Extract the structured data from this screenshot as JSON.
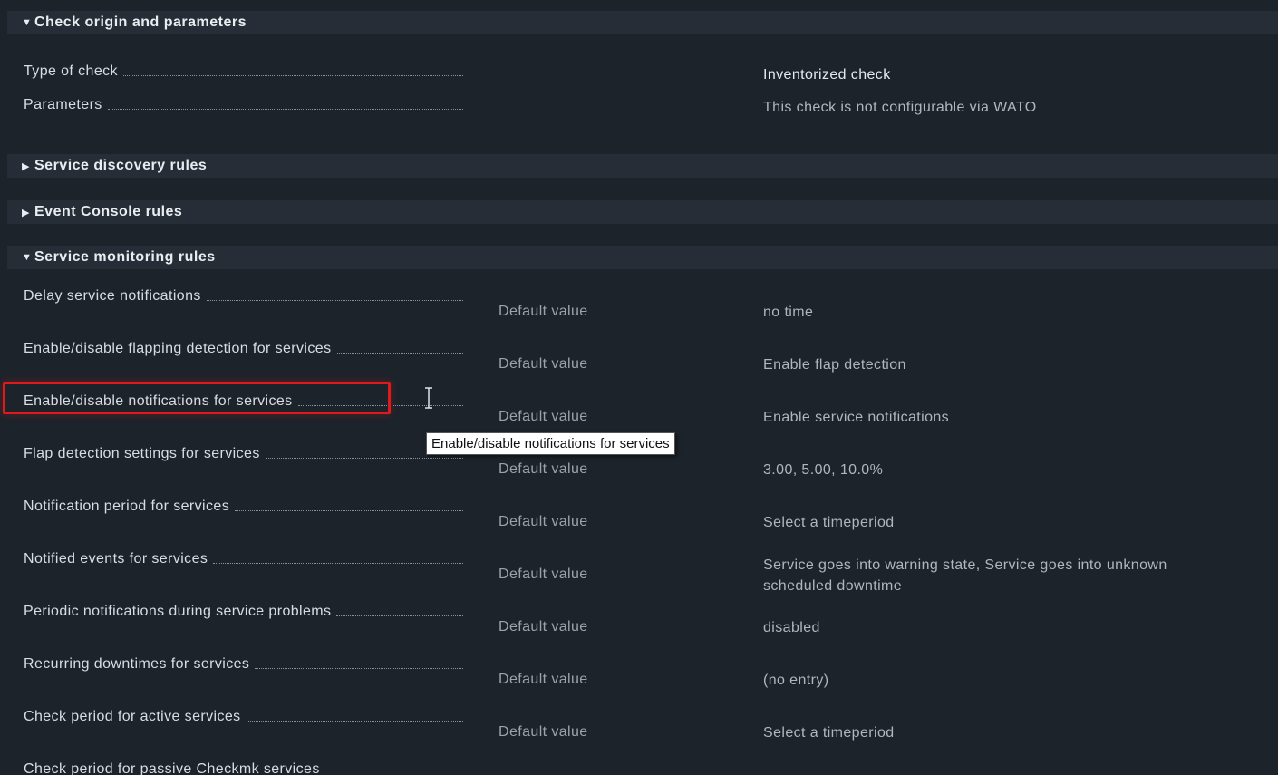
{
  "sections": {
    "origin": {
      "title": "Check origin and parameters",
      "expanded": true,
      "rows": [
        {
          "label": "Type of check",
          "value": "Inventorized check"
        },
        {
          "label": "Parameters",
          "value": "This check is not configurable via WATO"
        }
      ]
    },
    "discovery": {
      "title": "Service discovery rules",
      "expanded": false
    },
    "event_console": {
      "title": "Event Console rules",
      "expanded": false
    },
    "monitoring": {
      "title": "Service monitoring rules",
      "expanded": true,
      "rows": [
        {
          "label": "Delay service notifications",
          "setting": "Default value",
          "value": "no time"
        },
        {
          "label": "Enable/disable flapping detection for services",
          "setting": "Default value",
          "value": "Enable flap detection"
        },
        {
          "label": "Enable/disable notifications for services",
          "setting": "Default value",
          "value": "Enable service notifications"
        },
        {
          "label": "Flap detection settings for services",
          "setting": "Default value",
          "value": "3.00, 5.00, 10.0%"
        },
        {
          "label": "Notification period for services",
          "setting": "Default value",
          "value": "Select a timeperiod"
        },
        {
          "label": "Notified events for services",
          "setting": "Default value",
          "value": "Service goes into warning state, Service goes into unknown",
          "value2": "scheduled downtime"
        },
        {
          "label": "Periodic notifications during service problems",
          "setting": "Default value",
          "value": "disabled"
        },
        {
          "label": "Recurring downtimes for services",
          "setting": "Default value",
          "value": "(no entry)"
        },
        {
          "label": "Check period for active services",
          "setting": "Default value",
          "value": "Select a timeperiod"
        },
        {
          "label": "Check period for passive Checkmk services"
        }
      ]
    }
  },
  "tooltip": "Enable/disable notifications for services",
  "colors": {
    "background": "#1d232b",
    "header": "#262d36",
    "highlight": "#e0191c"
  },
  "icons": {
    "expanded": "triangle-down-icon",
    "collapsed": "triangle-right-icon",
    "cursor": "text-cursor-icon"
  }
}
